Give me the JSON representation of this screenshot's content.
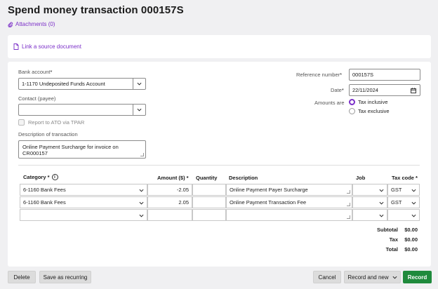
{
  "page": {
    "title": "Spend money transaction 000157S",
    "attachments_label": "Attachments (0)",
    "link_source_label": "Link a source document"
  },
  "form": {
    "bank_account_label": "Bank account",
    "bank_account_value": "1-1170  Undeposited Funds Account",
    "contact_label": "Contact (payee)",
    "contact_value": "",
    "report_tpar_label": "Report to ATO via TPAR",
    "description_label": "Description of transaction",
    "description_value": "Online Payment Surcharge for invoice on CR000157",
    "reference_label": "Reference number",
    "reference_value": "000157S",
    "date_label": "Date",
    "date_value": "22/11/2024",
    "amounts_are_label": "Amounts are",
    "tax_inclusive_label": "Tax inclusive",
    "tax_exclusive_label": "Tax exclusive",
    "required_mark": "*"
  },
  "table": {
    "headers": {
      "category": "Category *",
      "amount": "Amount ($) *",
      "quantity": "Quantity",
      "description": "Description",
      "job": "Job",
      "tax_code": "Tax code *"
    },
    "rows": [
      {
        "category": "6-1160  Bank Fees",
        "amount": "-2.05",
        "quantity": "",
        "description": "Online Payment Payer Surcharge",
        "job": "",
        "tax_code": "GST"
      },
      {
        "category": "6-1160  Bank Fees",
        "amount": "2.05",
        "quantity": "",
        "description": "Online Payment Transaction Fee",
        "job": "",
        "tax_code": "GST"
      },
      {
        "category": "",
        "amount": "",
        "quantity": "",
        "description": "",
        "job": "",
        "tax_code": ""
      }
    ]
  },
  "totals": {
    "subtotal_label": "Subtotal",
    "subtotal_value": "$0.00",
    "tax_label": "Tax",
    "tax_value": "$0.00",
    "total_label": "Total",
    "total_value": "$0.00"
  },
  "footer": {
    "delete_label": "Delete",
    "save_recurring_label": "Save as recurring",
    "cancel_label": "Cancel",
    "record_new_label": "Record and new",
    "record_label": "Record"
  },
  "colors": {
    "accent": "#7b2fc8",
    "record_button": "#1f8a3c"
  }
}
